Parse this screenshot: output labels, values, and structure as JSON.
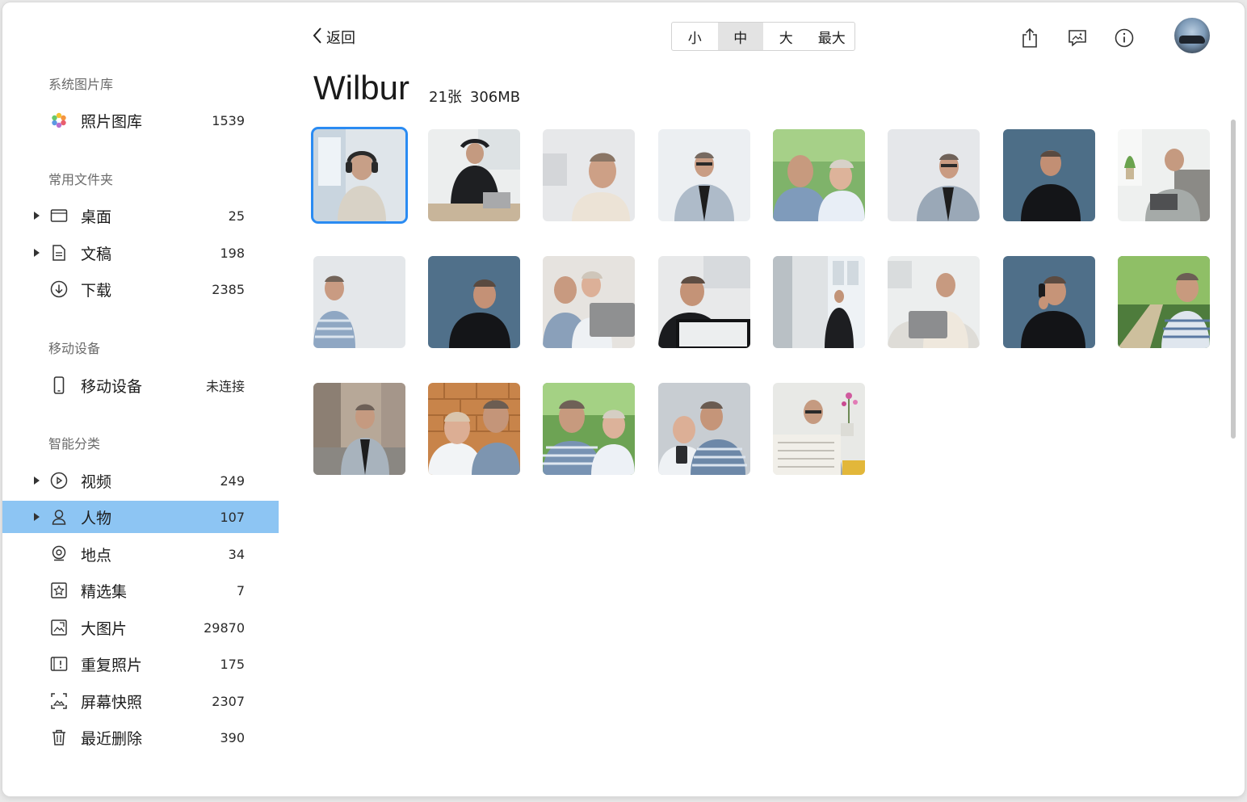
{
  "sidebar": {
    "sections": [
      {
        "title": "系统图片库"
      },
      {
        "title": "常用文件夹"
      },
      {
        "title": "移动设备"
      },
      {
        "title": "智能分类"
      }
    ],
    "items": [
      {
        "label": "照片图库",
        "count": "1539",
        "icon": "photos-app-icon"
      },
      {
        "label": "桌面",
        "count": "25",
        "icon": "desktop-icon"
      },
      {
        "label": "文稿",
        "count": "198",
        "icon": "document-icon"
      },
      {
        "label": "下载",
        "count": "2385",
        "icon": "download-icon"
      },
      {
        "label": "移动设备",
        "count": "未连接",
        "icon": "phone-icon"
      },
      {
        "label": "视频",
        "count": "249",
        "icon": "video-icon"
      },
      {
        "label": "人物",
        "count": "107",
        "icon": "person-icon"
      },
      {
        "label": "地点",
        "count": "34",
        "icon": "location-icon"
      },
      {
        "label": "精选集",
        "count": "7",
        "icon": "featured-icon"
      },
      {
        "label": "大图片",
        "count": "29870",
        "icon": "large-image-icon"
      },
      {
        "label": "重复照片",
        "count": "175",
        "icon": "duplicate-icon"
      },
      {
        "label": "屏幕快照",
        "count": "2307",
        "icon": "screenshot-icon"
      },
      {
        "label": "最近删除",
        "count": "390",
        "icon": "trash-icon"
      }
    ]
  },
  "toolbar": {
    "back_label": "返回",
    "sizes": [
      "小",
      "中",
      "大",
      "最大"
    ],
    "selected_size": "中"
  },
  "album": {
    "title": "Wilbur",
    "count": "21张",
    "size": "306MB"
  },
  "colors": {
    "accent": "#2a8bf2",
    "sidebar_active": "#8dc5f3"
  }
}
